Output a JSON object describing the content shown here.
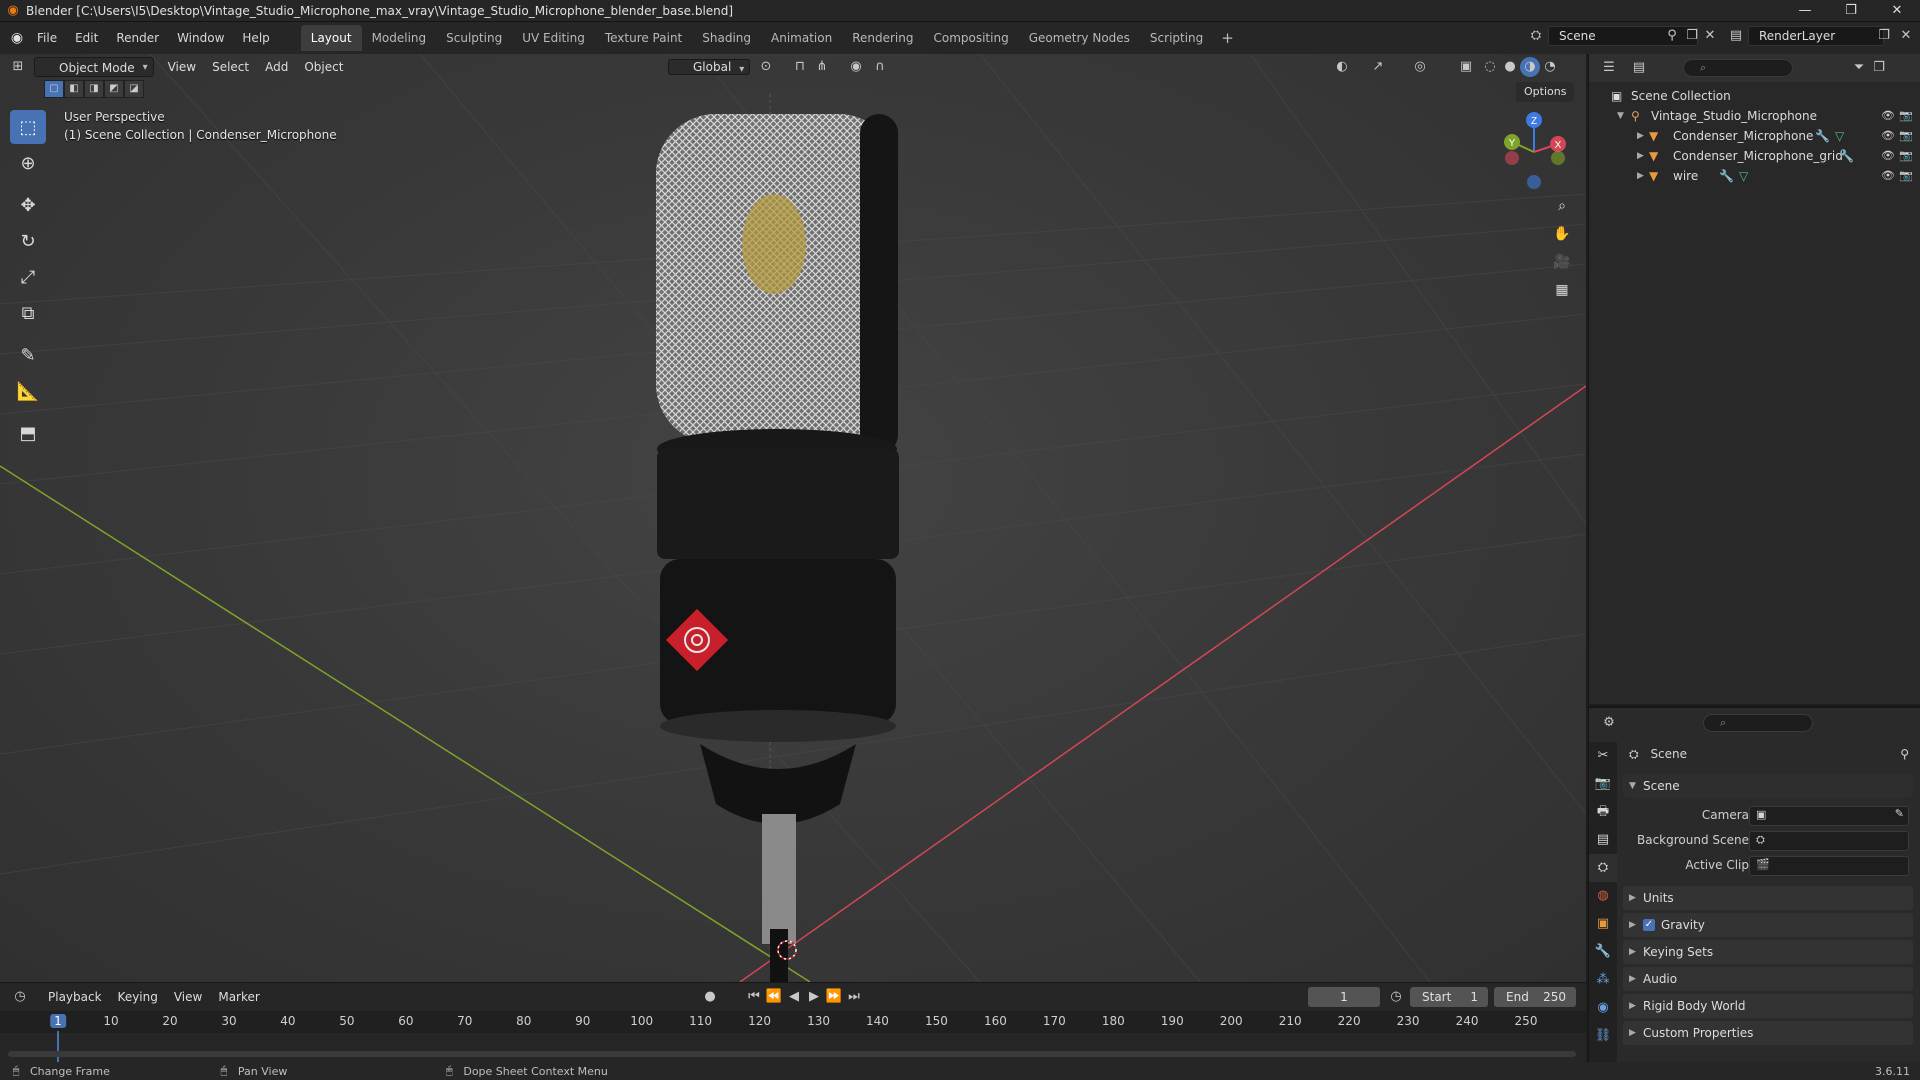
{
  "window": {
    "title": "Blender [C:\\Users\\I5\\Desktop\\Vintage_Studio_Microphone_max_vray\\Vintage_Studio_Microphone_blender_base.blend]",
    "controls": [
      "—",
      "❐",
      "✕"
    ]
  },
  "menu": {
    "items": [
      "File",
      "Edit",
      "Render",
      "Window",
      "Help"
    ],
    "workspaces": [
      "Layout",
      "Modeling",
      "Sculpting",
      "UV Editing",
      "Texture Paint",
      "Shading",
      "Animation",
      "Rendering",
      "Compositing",
      "Geometry Nodes",
      "Scripting"
    ],
    "active_workspace": "Layout",
    "add_tab": "+",
    "scene_name": "Scene",
    "view_layer": "RenderLayer"
  },
  "viewport": {
    "mode": "Object Mode",
    "menus": [
      "View",
      "Select",
      "Add",
      "Object"
    ],
    "transform_orientation": "Global",
    "options_label": "Options",
    "perspective_label": "User Perspective",
    "collection_label": "(1) Scene Collection | Condenser_Microphone",
    "gizmo_axes": {
      "x": "X",
      "y": "Y",
      "z": "Z"
    },
    "colors": {
      "x_axis": "#d34656",
      "y_axis": "#7ea42a",
      "z_axis": "#3d7be0",
      "selection": "#4772b3"
    }
  },
  "outliner": {
    "root": "Scene Collection",
    "collection": "Vintage_Studio_Microphone",
    "objects": [
      {
        "name": "Condenser_Microphone"
      },
      {
        "name": "Condenser_Microphone_grid"
      },
      {
        "name": "wire"
      }
    ]
  },
  "properties": {
    "context_title": "Scene",
    "panel_scene": "Scene",
    "fields": [
      {
        "label": "Camera"
      },
      {
        "label": "Background Scene"
      },
      {
        "label": "Active Clip"
      }
    ],
    "panels": [
      "Units",
      "Gravity",
      "Keying Sets",
      "Audio",
      "Rigid Body World",
      "Custom Properties"
    ],
    "gravity_checked": true
  },
  "timeline": {
    "menus": [
      "Playback",
      "Keying",
      "View",
      "Marker"
    ],
    "current_frame": "1",
    "start_label": "Start",
    "start_value": "1",
    "end_label": "End",
    "end_value": "250",
    "ticks": [
      "1",
      "10",
      "20",
      "30",
      "40",
      "50",
      "60",
      "70",
      "80",
      "90",
      "100",
      "110",
      "120",
      "130",
      "140",
      "150",
      "160",
      "170",
      "180",
      "190",
      "200",
      "210",
      "220",
      "230",
      "240",
      "250"
    ]
  },
  "status": {
    "hints": [
      "Change Frame",
      "Pan View",
      "Dope Sheet Context Menu"
    ],
    "version": "3.6.11"
  }
}
